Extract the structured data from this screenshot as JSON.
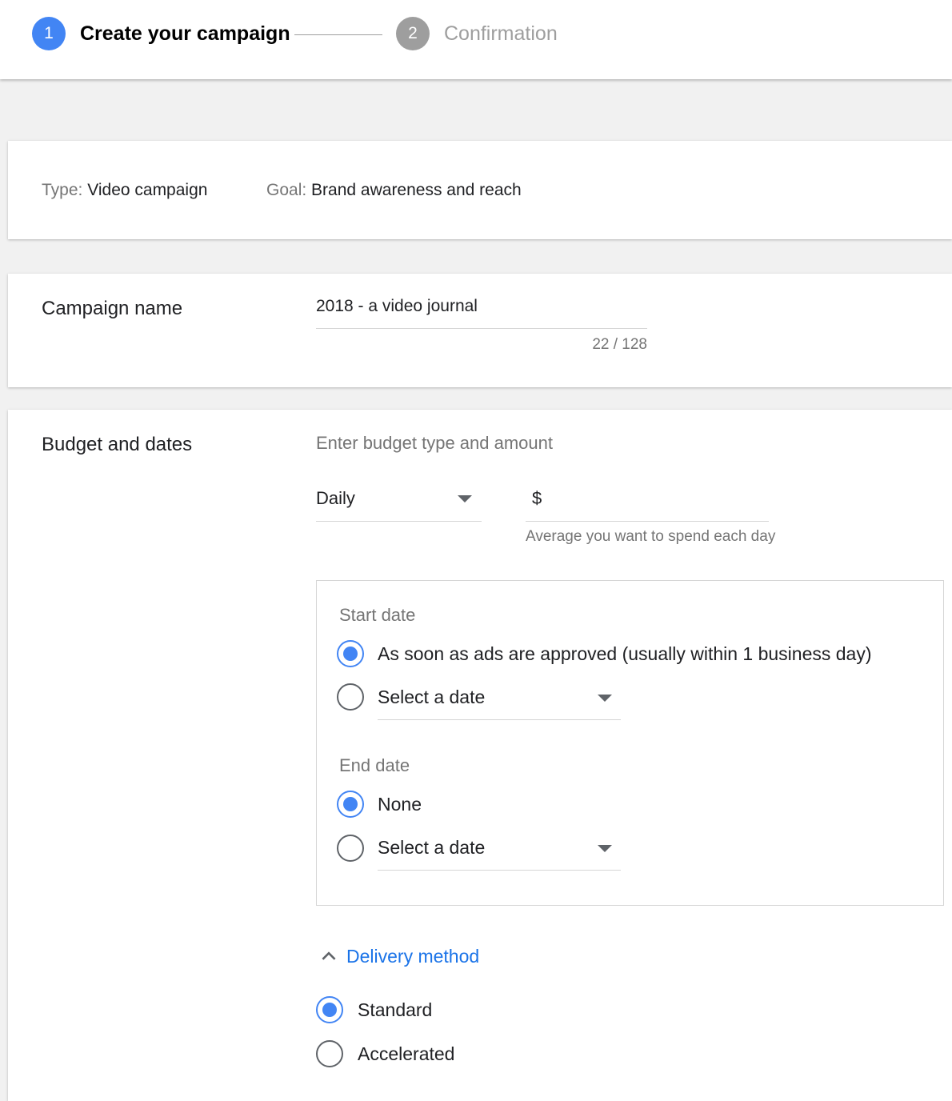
{
  "stepper": {
    "step1": {
      "number": "1",
      "label": "Create your campaign"
    },
    "step2": {
      "number": "2",
      "label": "Confirmation"
    }
  },
  "summary": {
    "type_label": "Type:",
    "type_value": "Video campaign",
    "goal_label": "Goal:",
    "goal_value": "Brand awareness and reach"
  },
  "campaign_name": {
    "heading": "Campaign name",
    "value": "2018 - a video journal",
    "counter": "22 / 128"
  },
  "budget": {
    "heading": "Budget and dates",
    "hint": "Enter budget type and amount",
    "type_selected": "Daily",
    "currency_symbol": "$",
    "amount_value": "",
    "amount_helper": "Average you want to spend each day"
  },
  "start_date": {
    "heading": "Start date",
    "option1": "As soon as ads are approved (usually within 1 business day)",
    "option2": "Select a date",
    "selected": "option1"
  },
  "end_date": {
    "heading": "End date",
    "option1": "None",
    "option2": "Select a date",
    "selected": "option1"
  },
  "delivery": {
    "toggle_label": "Delivery method",
    "expanded": true,
    "option1": "Standard",
    "option2": "Accelerated",
    "selected": "option1"
  },
  "colors": {
    "accent": "#4285f4",
    "link": "#1a73e8",
    "inactive_step": "#9e9e9e",
    "page_background": "#f1f1f1"
  },
  "icons": {
    "expand": "chevron-up-icon",
    "dropdown": "caret-down-icon"
  }
}
